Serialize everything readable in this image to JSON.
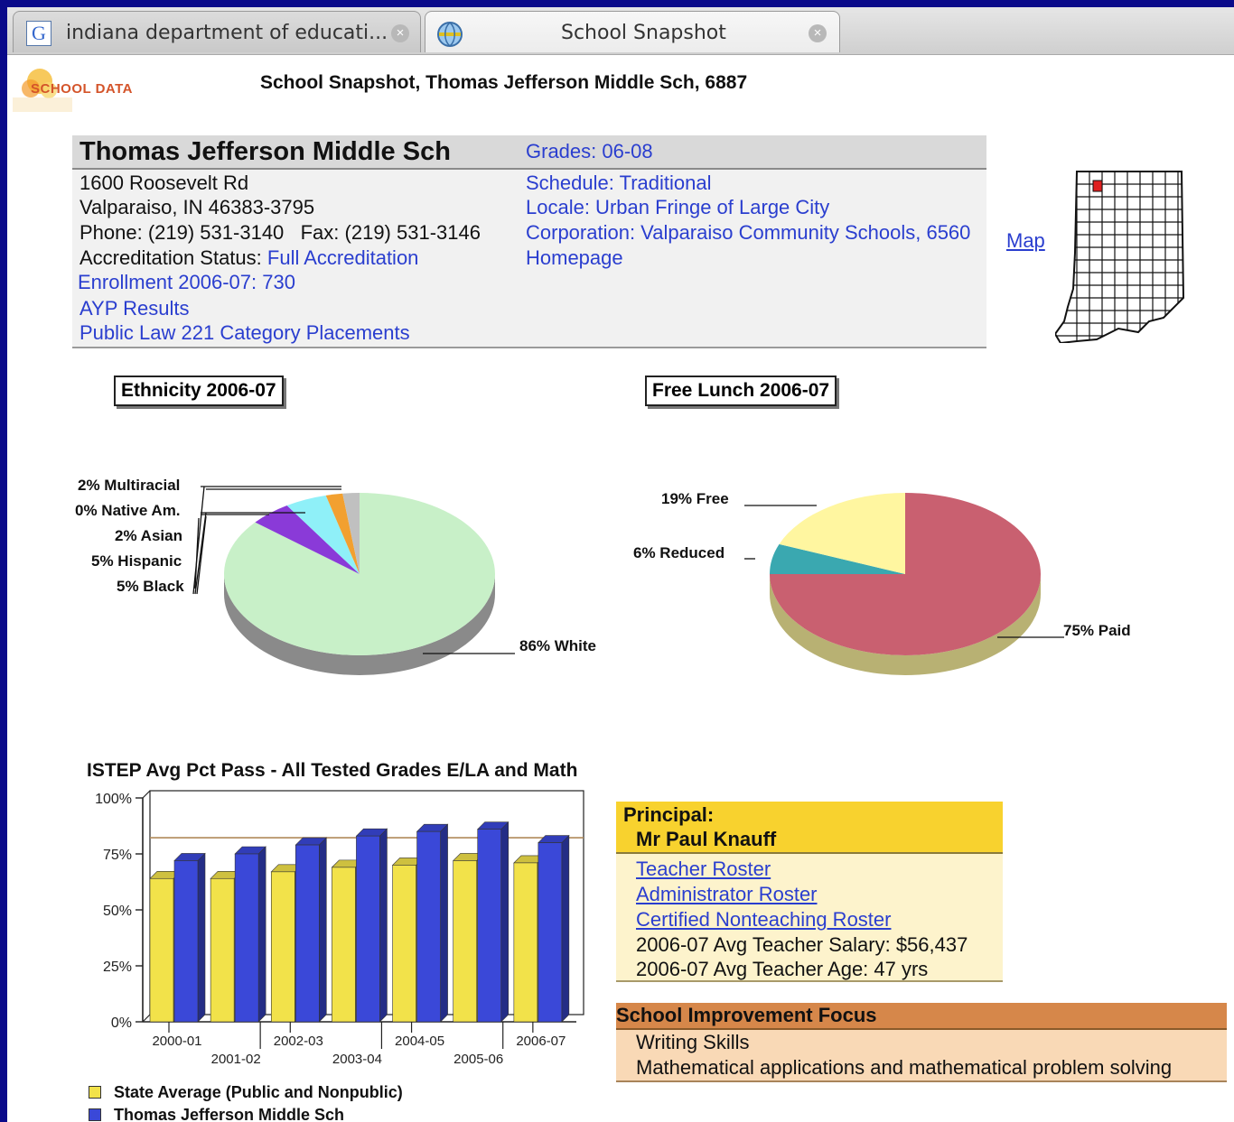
{
  "browser": {
    "tabs": [
      {
        "title": "indiana department of educati..."
      },
      {
        "title": "School Snapshot"
      }
    ]
  },
  "header": {
    "logo_text": "SCHOOL DATA",
    "title": "School Snapshot, Thomas Jefferson Middle Sch, 6887"
  },
  "school": {
    "name": "Thomas Jefferson Middle Sch",
    "address1": "1600 Roosevelt Rd",
    "address2": "Valparaiso, IN 46383-3795",
    "phone": "Phone: (219) 531-3140   Fax: (219) 531-3146",
    "accreditation_label": "Accreditation Status: ",
    "accreditation_value": "Full Accreditation",
    "enrollment": "Enrollment 2006-07: 730",
    "ayp": "AYP Results",
    "pl221": "Public Law 221 Category Placements",
    "grades": "Grades: 06-08",
    "schedule": "Schedule: Traditional",
    "locale": "Locale: Urban Fringe of Large City",
    "corporation": "Corporation: Valparaiso Community Schools, 6560",
    "homepage": "Homepage",
    "map_link": "Map"
  },
  "colors": {
    "white_slice": "#c8f0c8",
    "black_slice": "#8a3ad8",
    "hispanic_slice": "#8ff0f8",
    "asian_slice": "#f2a030",
    "multi_slice": "#c0c0c0",
    "paid_slice": "#c96070",
    "free_slice": "#fff6a0",
    "reduced_slice": "#3aa8b0",
    "state_bar": "#f2e24a",
    "school_bar": "#3a48d8",
    "map_marker": "#e02020"
  },
  "ethnicity": {
    "title": "Ethnicity 2006-07",
    "labels": {
      "multiracial": "2%  Multiracial",
      "native": "0%  Native Am.",
      "asian": "2%  Asian",
      "hispanic": "5%  Hispanic",
      "black": "5%  Black",
      "white": "86%  White"
    }
  },
  "lunch": {
    "title": "Free Lunch 2006-07",
    "labels": {
      "free": "19%  Free",
      "reduced": "6%  Reduced",
      "paid": "75%  Paid"
    }
  },
  "chart_data": [
    {
      "type": "pie",
      "title": "Ethnicity 2006-07",
      "categories": [
        "Multiracial",
        "Native Am.",
        "Asian",
        "Hispanic",
        "Black",
        "White"
      ],
      "values": [
        2,
        0,
        2,
        5,
        5,
        86
      ]
    },
    {
      "type": "pie",
      "title": "Free Lunch 2006-07",
      "categories": [
        "Free",
        "Reduced",
        "Paid"
      ],
      "values": [
        19,
        6,
        75
      ]
    },
    {
      "type": "bar",
      "title": "ISTEP Avg Pct Pass - All Tested Grades E/LA and Math",
      "categories": [
        "2000-01",
        "2001-02",
        "2002-03",
        "2003-04",
        "2004-05",
        "2005-06",
        "2006-07"
      ],
      "series": [
        {
          "name": "State Average (Public and Nonpublic)",
          "values": [
            64,
            64,
            67,
            69,
            70,
            72,
            71
          ]
        },
        {
          "name": "Thomas Jefferson Middle Sch",
          "values": [
            72,
            75,
            79,
            83,
            85,
            86,
            80
          ]
        }
      ],
      "yticks": [
        "0%",
        "25%",
        "50%",
        "75%",
        "100%"
      ],
      "ylim": [
        0,
        100
      ],
      "reference_line": 79
    }
  ],
  "principal": {
    "heading": "Principal:",
    "name": "Mr Paul Knauff",
    "teacher_roster": "Teacher Roster",
    "admin_roster": "Administrator Roster",
    "nonteaching_roster": "Certified Nonteaching Roster",
    "salary": "2006-07 Avg Teacher Salary: $56,437",
    "age": "2006-07 Avg Teacher Age: 47 yrs"
  },
  "improvement": {
    "heading": "School Improvement Focus",
    "items": [
      "Writing Skills",
      "Mathematical applications and mathematical problem solving"
    ]
  }
}
